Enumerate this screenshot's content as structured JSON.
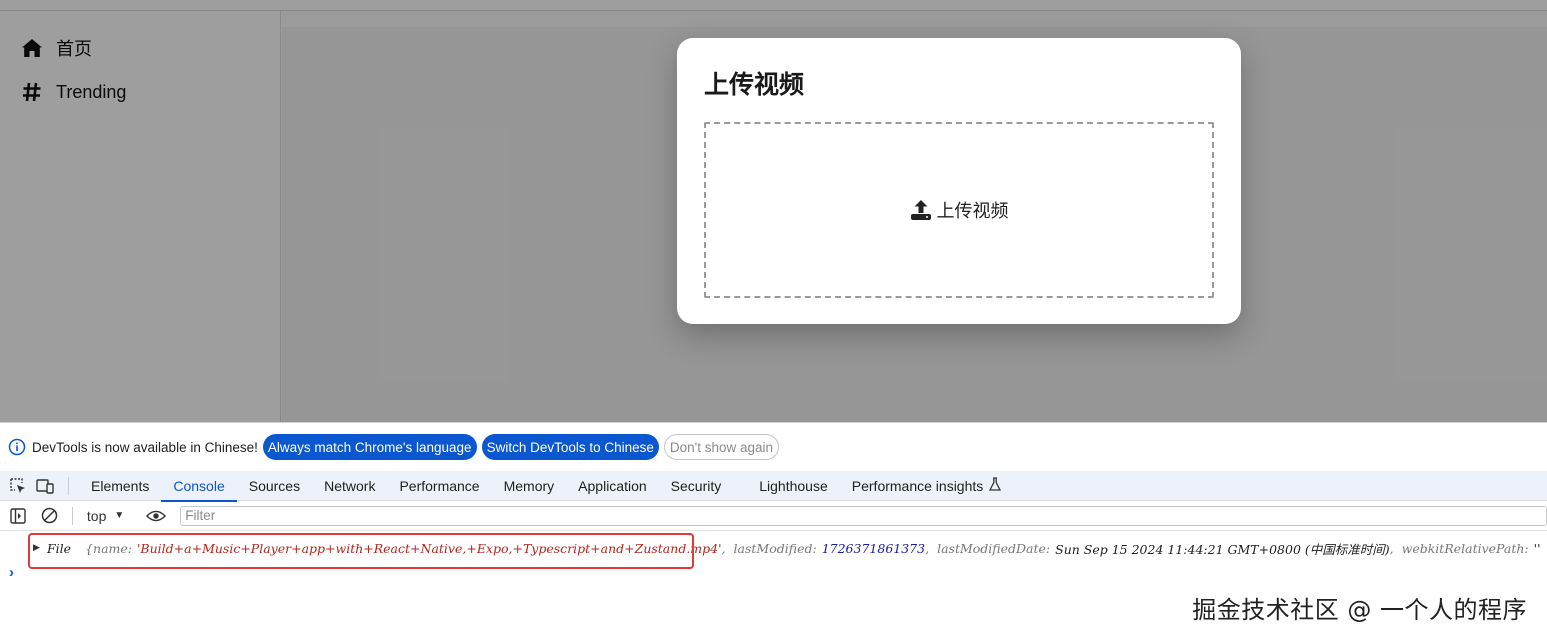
{
  "sidebar": {
    "items": [
      {
        "label": "首页",
        "icon": "home-icon"
      },
      {
        "label": "Trending",
        "icon": "hashtag-icon"
      }
    ]
  },
  "modal": {
    "title": "上传视频",
    "dropzone_label": "上传视频",
    "dropzone_icon": "upload-icon"
  },
  "devtools": {
    "infobar": {
      "message": "DevTools is now available in Chinese!",
      "buttons": [
        "Always match Chrome's language",
        "Switch DevTools to Chinese",
        "Don't show again"
      ]
    },
    "tabs": [
      "Elements",
      "Console",
      "Sources",
      "Network",
      "Performance",
      "Memory",
      "Application",
      "Security",
      "Lighthouse",
      "Performance insights"
    ],
    "active_tab": "Console",
    "context": "top",
    "filter_placeholder": "Filter",
    "log": {
      "type": "File",
      "name_key": "name:",
      "name_value": "'Build+a+Music+Player+app+with+React+Native,+Expo,+Typescript+and+Zustand.mp4'",
      "last_modified_key": "lastModified:",
      "last_modified_value": "1726371861373",
      "last_modified_date_key": "lastModifiedDate:",
      "last_modified_date_value": "Sun Sep 15 2024 11:44:21 GMT+0800 (中国标准时间)",
      "relative_path_key": "webkitRelativePath:",
      "relative_path_value": "''"
    },
    "prompt": "›"
  },
  "watermark": "掘金技术社区 @ 一个人的程序",
  "colors": {
    "accent": "#0b57d0",
    "highlight": "#e53935",
    "string": "#b3261e"
  }
}
